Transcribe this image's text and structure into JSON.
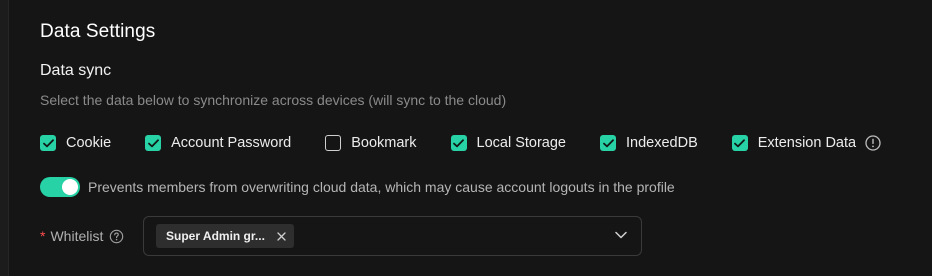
{
  "page": {
    "title": "Data Settings"
  },
  "data_sync": {
    "title": "Data sync",
    "description": "Select the data below to synchronize across devices (will sync to the cloud)",
    "options": [
      {
        "label": "Cookie",
        "checked": true
      },
      {
        "label": "Account Password",
        "checked": true
      },
      {
        "label": "Bookmark",
        "checked": false
      },
      {
        "label": "Local Storage",
        "checked": true
      },
      {
        "label": "IndexedDB",
        "checked": true
      },
      {
        "label": "Extension Data",
        "checked": true
      }
    ],
    "info_icon": "info-circle-icon"
  },
  "overwrite_toggle": {
    "enabled": true,
    "label": "Prevents members from overwriting cloud data, which may cause account logouts in the profile"
  },
  "whitelist": {
    "required_mark": "*",
    "label": "Whitelist",
    "help_icon": "question-circle-icon",
    "selected_tags": [
      "Super Admin gr..."
    ],
    "dropdown_icon": "chevron-down-icon"
  },
  "colors": {
    "accent": "#27d3a6",
    "background": "#151515",
    "required": "#ff4d4f"
  }
}
